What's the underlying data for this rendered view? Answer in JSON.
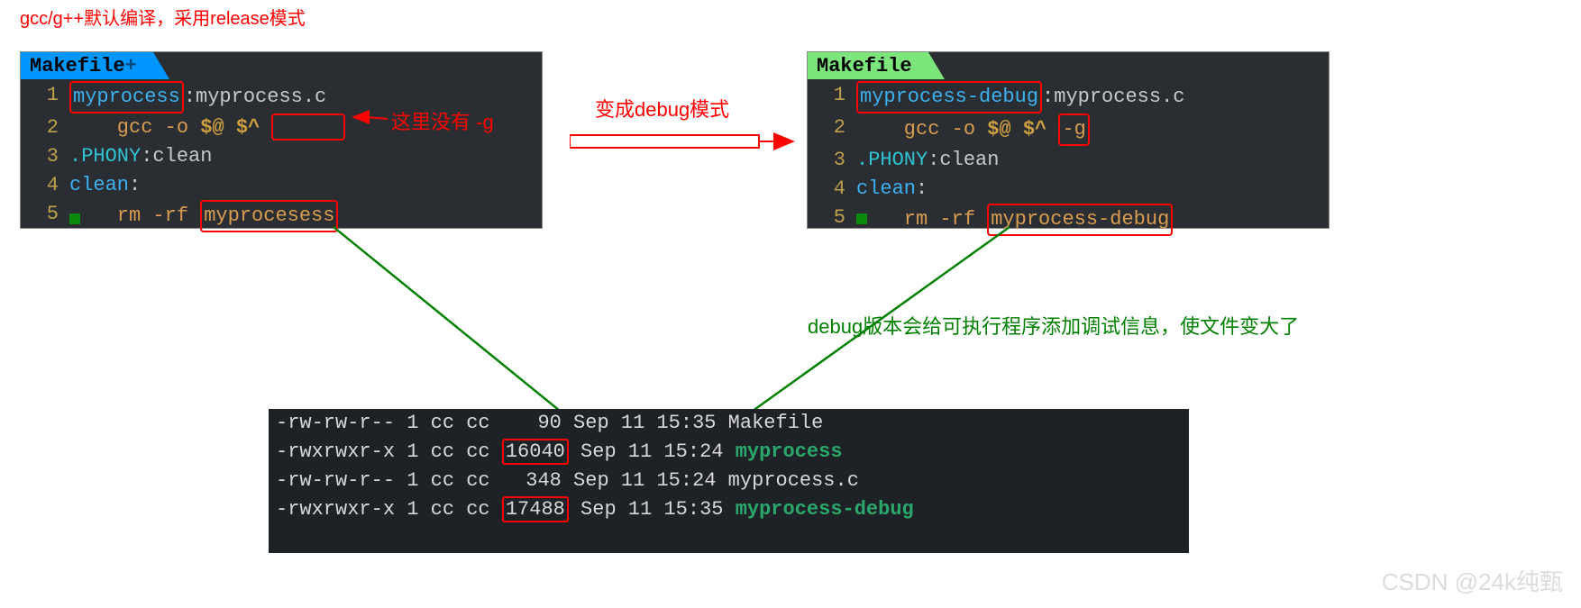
{
  "annotations": {
    "top": "gcc/g++默认编译，采用release模式",
    "no_g": "这里没有 -g",
    "become_debug": "变成debug模式",
    "debug_larger": "debug版本会给可执行程序添加调试信息，使文件变大了",
    "watermark": "CSDN @24k纯甄"
  },
  "left_editor": {
    "tab": "Makefile",
    "tab_suffix": "+",
    "lines": [
      {
        "no": "1",
        "parts": [
          {
            "cls": "target red-box",
            "t": "myprocess"
          },
          {
            "cls": "grey",
            "t": ":"
          },
          {
            "cls": "grey",
            "t": "myprocess.c"
          }
        ]
      },
      {
        "no": "2",
        "parts": [
          {
            "cls": "orange",
            "t": "    gcc "
          },
          {
            "cls": "orange",
            "t": "-o "
          },
          {
            "cls": "gold",
            "t": "$@ "
          },
          {
            "cls": "gold",
            "t": "$^"
          },
          {
            "cls": "",
            "t": " "
          },
          {
            "cls": "red-box-empty",
            "t": ""
          }
        ]
      },
      {
        "no": "3",
        "parts": [
          {
            "cls": "cyan",
            "t": ".PHONY"
          },
          {
            "cls": "grey",
            "t": ":clean"
          }
        ]
      },
      {
        "no": "4",
        "parts": [
          {
            "cls": "target",
            "t": "clean"
          },
          {
            "cls": "grey",
            "t": ":"
          }
        ]
      },
      {
        "no": "5",
        "parts": [
          {
            "cls": "orange",
            "t": "    rm -rf "
          },
          {
            "cls": "orange red-box",
            "t": "myprocesess"
          }
        ]
      }
    ]
  },
  "right_editor": {
    "tab": "Makefile",
    "lines": [
      {
        "no": "1",
        "parts": [
          {
            "cls": "target red-box",
            "t": "myprocess-debug"
          },
          {
            "cls": "grey",
            "t": ":myprocess.c"
          }
        ]
      },
      {
        "no": "2",
        "parts": [
          {
            "cls": "orange",
            "t": "    gcc -o "
          },
          {
            "cls": "gold",
            "t": "$@ "
          },
          {
            "cls": "gold",
            "t": "$^"
          },
          {
            "cls": "orange",
            "t": " "
          },
          {
            "cls": "orange red-box",
            "t": "-g"
          }
        ]
      },
      {
        "no": "3",
        "parts": [
          {
            "cls": "cyan",
            "t": ".PHONY"
          },
          {
            "cls": "grey",
            "t": ":clean"
          }
        ]
      },
      {
        "no": "4",
        "parts": [
          {
            "cls": "target",
            "t": "clean"
          },
          {
            "cls": "grey",
            "t": ":"
          }
        ]
      },
      {
        "no": "5",
        "parts": [
          {
            "cls": "orange",
            "t": "    rm -rf "
          },
          {
            "cls": "orange red-box",
            "t": "myprocess-debug"
          }
        ]
      }
    ]
  },
  "terminal": {
    "rows": [
      {
        "perms": "-rw-rw-r--",
        "links": "1",
        "owner": "cc",
        "group": "cc",
        "size": "90",
        "date": "Sep 11 15:35",
        "name": "Makefile",
        "cls": ""
      },
      {
        "perms": "-rwxrwxr-x",
        "links": "1",
        "owner": "cc",
        "group": "cc",
        "size": "16040",
        "date": "Sep 11 15:24",
        "name": "myprocess",
        "cls": "term-green",
        "box": true
      },
      {
        "perms": "-rw-rw-r--",
        "links": "1",
        "owner": "cc",
        "group": "cc",
        "size": "348",
        "date": "Sep 11 15:24",
        "name": "myprocess.c",
        "cls": ""
      },
      {
        "perms": "-rwxrwxr-x",
        "links": "1",
        "owner": "cc",
        "group": "cc",
        "size": "17488",
        "date": "Sep 11 15:35",
        "name": "myprocess-debug",
        "cls": "term-green",
        "box": true
      }
    ]
  }
}
